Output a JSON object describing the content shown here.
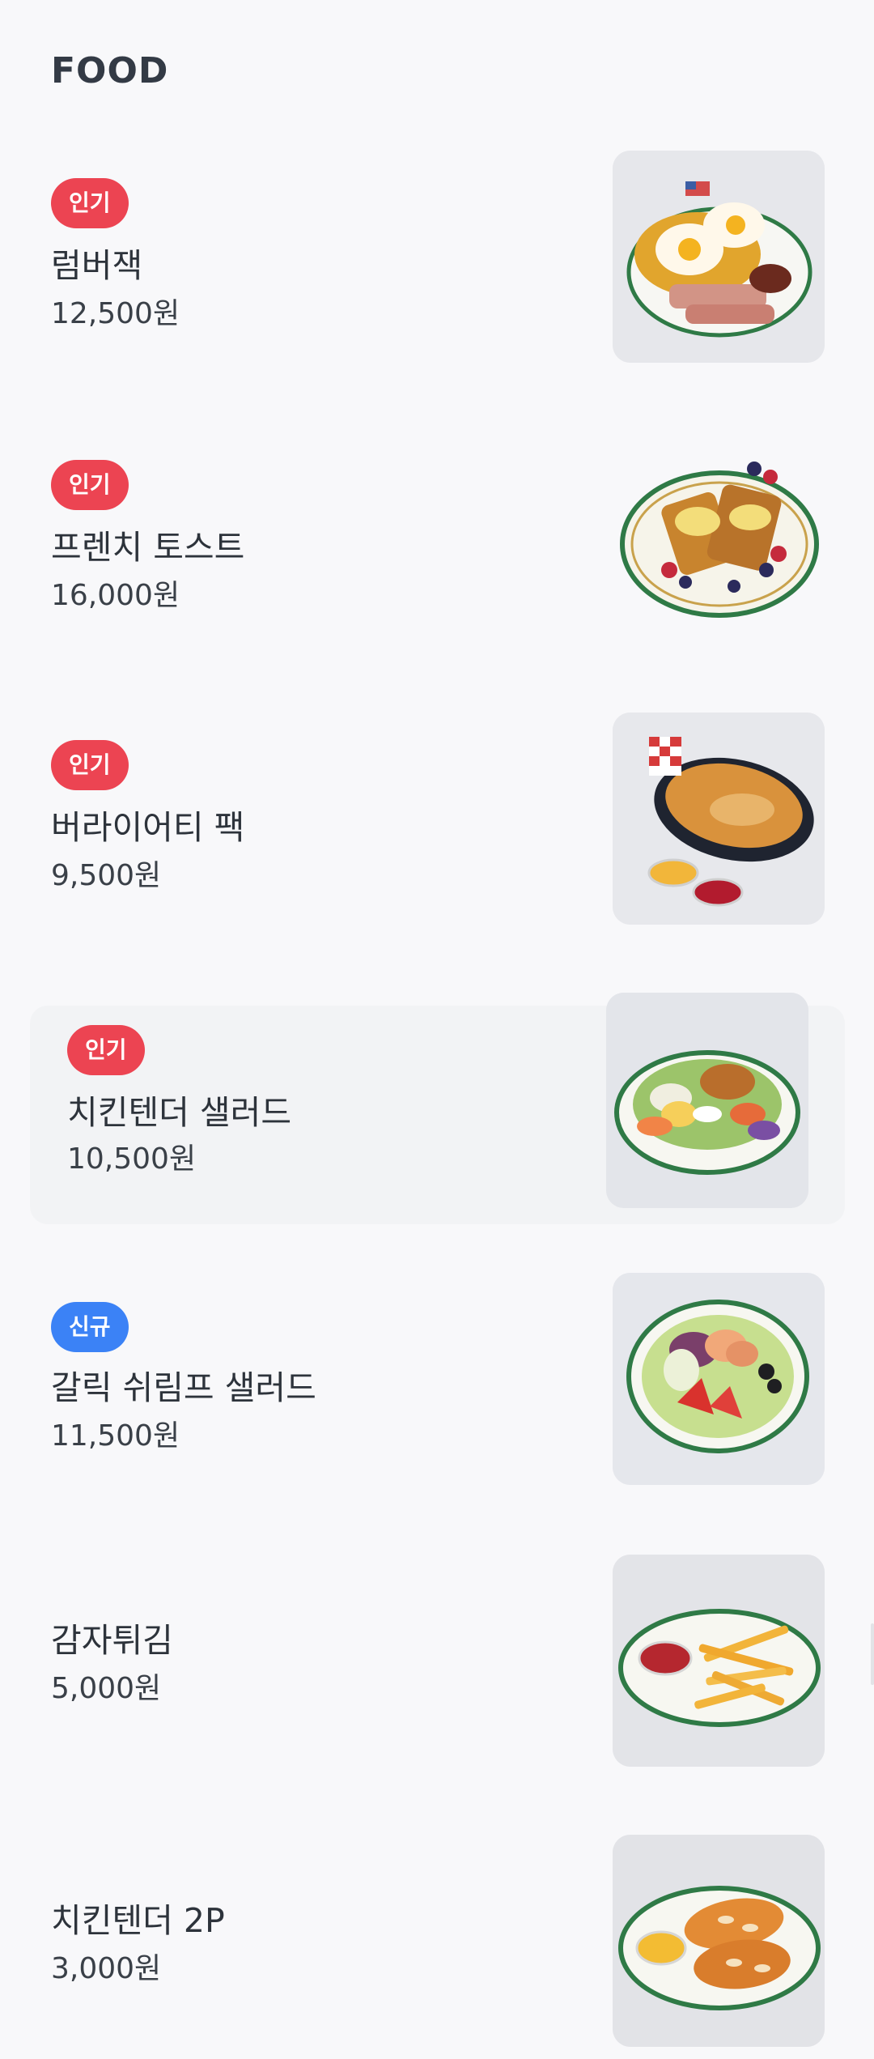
{
  "section": {
    "title": "FOOD"
  },
  "items": [
    {
      "badge": "인기",
      "badge_type": "popular",
      "name": "럼버잭",
      "price": "12,500원",
      "image": "lumberjack-breakfast-plate"
    },
    {
      "badge": "인기",
      "badge_type": "popular",
      "name": "프렌치 토스트",
      "price": "16,000원",
      "image": "french-toast-plate"
    },
    {
      "badge": "인기",
      "badge_type": "popular",
      "name": "버라이어티 팩",
      "price": "9,500원",
      "image": "variety-pack-basket"
    },
    {
      "badge": "인기",
      "badge_type": "popular",
      "name": "치킨텐더 샐러드",
      "price": "10,500원",
      "image": "chicken-tender-salad-plate"
    },
    {
      "badge": "신규",
      "badge_type": "new",
      "name": "갈릭 쉬림프 샐러드",
      "price": "11,500원",
      "image": "garlic-shrimp-salad-plate"
    },
    {
      "badge": "",
      "badge_type": "none",
      "name": "감자튀김",
      "price": "5,000원",
      "image": "french-fries-plate"
    },
    {
      "badge": "",
      "badge_type": "none",
      "name": "치킨텐더 2P",
      "price": "3,000원",
      "image": "chicken-tender-plate"
    }
  ],
  "colors": {
    "badge_popular": "#ec4452",
    "badge_new": "#3b82f6",
    "highlight_bg": "#f2f3f5",
    "plate_rim": "#2f7a46"
  }
}
